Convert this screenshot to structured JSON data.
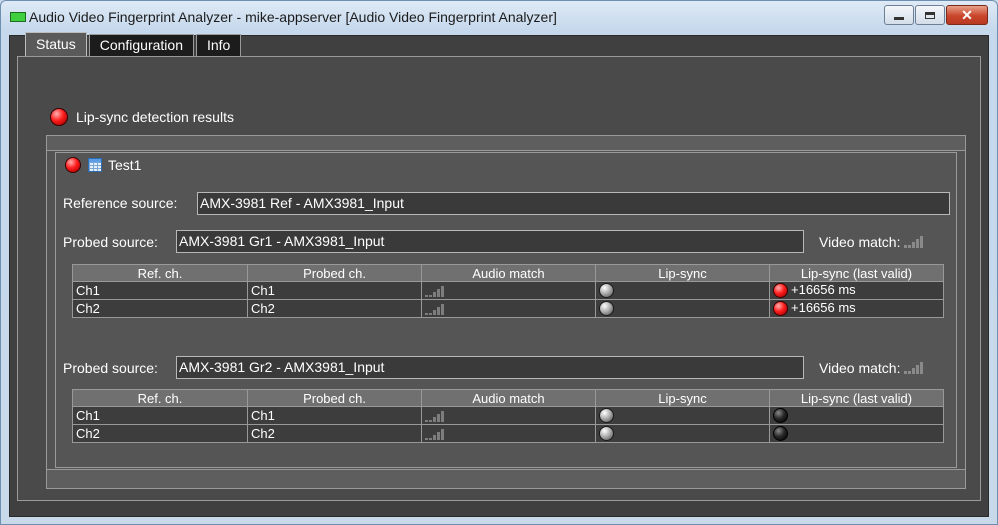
{
  "window": {
    "title": "Audio Video Fingerprint Analyzer - mike-appserver [Audio Video Fingerprint Analyzer]",
    "controls": {
      "minimize": "minimize",
      "maximize": "maximize",
      "close": "✕"
    }
  },
  "tabs": [
    {
      "label": "Status",
      "active": true
    },
    {
      "label": "Configuration",
      "active": false
    },
    {
      "label": "Info",
      "active": false
    }
  ],
  "status": {
    "results_label": "Lip-sync detection results",
    "results_status": "red",
    "test": {
      "name": "Test1",
      "status": "red",
      "reference_label": "Reference source:",
      "reference_value": "AMX-3981 Ref - AMX3981_Input",
      "probed": [
        {
          "label": "Probed source:",
          "value": "AMX-3981 Gr1 - AMX3981_Input",
          "video_match_label": "Video match:",
          "columns": [
            "Ref. ch.",
            "Probed ch.",
            "Audio match",
            "Lip-sync",
            "Lip-sync (last valid)"
          ],
          "rows": [
            {
              "ref": "Ch1",
              "probed": "Ch1",
              "audio_match": "signal-bars-icon",
              "lipsync": "grey",
              "last_valid_status": "red",
              "last_valid": "+16656 ms"
            },
            {
              "ref": "Ch2",
              "probed": "Ch2",
              "audio_match": "signal-bars-icon",
              "lipsync": "grey",
              "last_valid_status": "red",
              "last_valid": "+16656 ms"
            }
          ]
        },
        {
          "label": "Probed source:",
          "value": "AMX-3981 Gr2 - AMX3981_Input",
          "video_match_label": "Video match:",
          "columns": [
            "Ref. ch.",
            "Probed ch.",
            "Audio match",
            "Lip-sync",
            "Lip-sync (last valid)"
          ],
          "rows": [
            {
              "ref": "Ch1",
              "probed": "Ch1",
              "audio_match": "signal-bars-icon",
              "lipsync": "grey",
              "last_valid_status": "dark",
              "last_valid": ""
            },
            {
              "ref": "Ch2",
              "probed": "Ch2",
              "audio_match": "signal-bars-icon",
              "lipsync": "grey",
              "last_valid_status": "dark",
              "last_valid": ""
            }
          ]
        }
      ]
    }
  },
  "colors": {
    "panel_bg": "#404040",
    "led_red": "#ff1e1e",
    "led_grey": "#b0b0b0",
    "led_dark": "#2a2a2a"
  }
}
